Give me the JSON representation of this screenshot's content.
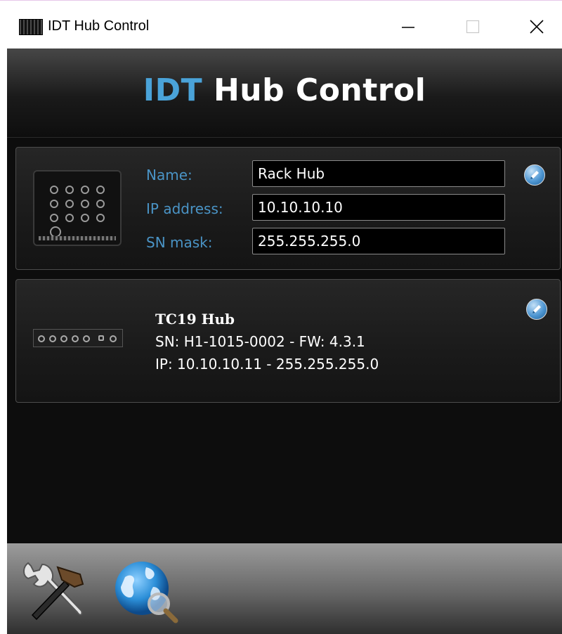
{
  "window": {
    "title": "IDT Hub Control",
    "controls": {
      "minimize_icon": "minimize-icon",
      "maximize_icon": "maximize-icon",
      "close_icon": "close-icon"
    }
  },
  "header": {
    "title_accent": "IDT",
    "title_rest": " Hub Control",
    "accent_color": "#4aa3d9"
  },
  "selected_hub": {
    "image": "hub-board-image",
    "fields": [
      {
        "label": "Name:",
        "value": "Rack Hub"
      },
      {
        "label": "IP address:",
        "value": "10.10.10.10"
      },
      {
        "label": "SN mask:",
        "value": "255.255.255.0"
      }
    ],
    "edit_icon": "pencil-icon"
  },
  "hubs": [
    {
      "image": "hub-strip-image",
      "name": "TC19 Hub",
      "sn_line": "SN: H1-1015-0002 - FW: 4.3.1",
      "ip_line": "IP: 10.10.10.11 - 255.255.255.0",
      "edit_icon": "pencil-icon"
    }
  ],
  "toolbar": {
    "settings_icon": "tools-icon",
    "discover_icon": "globe-search-icon"
  }
}
